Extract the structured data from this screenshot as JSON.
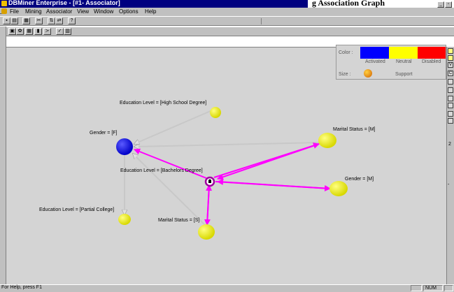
{
  "window": {
    "title": "DBMiner Enterprise - [#1- Associator]",
    "overlay_text": "g   Association Graph"
  },
  "menu": [
    "File",
    "Mining",
    "Associator",
    "View",
    "Window",
    "Options",
    "Help"
  ],
  "toolbar1": {
    "buttons": [
      {
        "name": "save-icon",
        "glyph": "▪"
      },
      {
        "name": "print-icon",
        "glyph": "▤"
      },
      {
        "name": "table-icon",
        "glyph": "▦"
      },
      {
        "name": "cut-icon",
        "glyph": "✂"
      },
      {
        "name": "sort-icon",
        "glyph": "⇅"
      },
      {
        "name": "filter-icon",
        "glyph": "⇄"
      },
      {
        "name": "help-icon",
        "glyph": "?"
      }
    ]
  },
  "toolbar2": {
    "buttons": [
      {
        "name": "rule-view-icon",
        "glyph": "▣"
      },
      {
        "name": "graph-view-icon",
        "glyph": "✿"
      },
      {
        "name": "grid-view-icon",
        "glyph": "▦"
      },
      {
        "name": "chart-view-icon",
        "glyph": "▮"
      },
      {
        "name": "link-view-icon",
        "glyph": "≻"
      },
      {
        "name": "check-icon",
        "glyph": "✓"
      },
      {
        "name": "export-icon",
        "glyph": "▥"
      }
    ]
  },
  "legend": {
    "color_label": "Color :",
    "size_label": "Size :",
    "support_label": "Support",
    "swatches": [
      {
        "label": "Activated",
        "color": "#0000ff"
      },
      {
        "label": "Neutral",
        "color": "#ffff00"
      },
      {
        "label": "Disabled",
        "color": "#ff0000"
      }
    ]
  },
  "graph": {
    "nodes": [
      {
        "id": "hs",
        "label": "Education Level = [High School Degree]",
        "color": "#ffff00"
      },
      {
        "id": "gf",
        "label": "Gender = [F]",
        "color": "#0000ff"
      },
      {
        "id": "mm",
        "label": "Marital Status = [M]",
        "color": "#ffff00"
      },
      {
        "id": "bd",
        "label": "Education Level = [Bachelors Degree]",
        "color": "#ffffff"
      },
      {
        "id": "gm",
        "label": "Gender = [M]",
        "color": "#ffff00"
      },
      {
        "id": "pc",
        "label": "Education Level = [Partial College]",
        "color": "#ffff00"
      },
      {
        "id": "ms",
        "label": "Marital Status = [S]",
        "color": "#ffff00"
      }
    ]
  },
  "status": {
    "message": "For Help, press F1",
    "indicator": "NUM"
  }
}
